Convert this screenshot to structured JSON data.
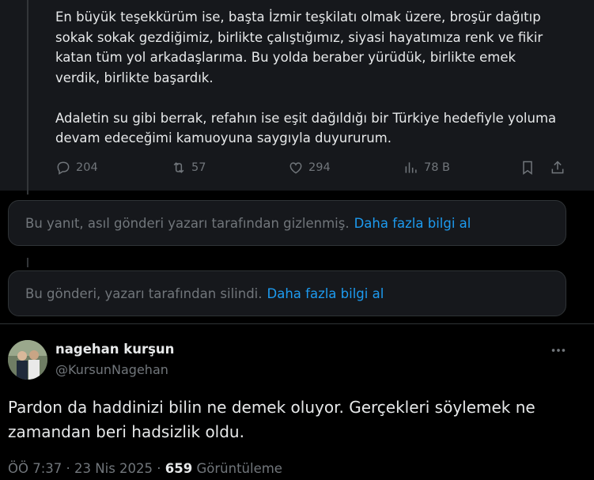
{
  "parent_tweet": {
    "text": "En büyük teşekkürüm ise, başta İzmir teşkilatı olmak üzere, broşür dağıtıp\nsokak sokak gezdiğimiz, birlikte çalıştığımız, siyasi hayatımıza renk ve fikir\nkatan tüm yol arkadaşlarıma. Bu yolda beraber yürüdük, birlikte emek\nverdik, birlikte başardık.\n\nAdaletin su gibi berrak, refahın ise eşit dağıldığı bir Türkiye hedefiyle yoluma\ndevam edeceğimi kamuoyuna saygıyla duyururum.",
    "replies": "204",
    "retweets": "57",
    "likes": "294",
    "views": "78 B"
  },
  "notices": [
    {
      "text": "Bu yanıt, asıl gönderi yazarı tarafından gizlenmiş.",
      "link": "Daha fazla bilgi al"
    },
    {
      "text": "Bu gönderi, yazarı tarafından silindi.",
      "link": "Daha fazla bilgi al"
    }
  ],
  "tweet": {
    "author_name": "nagehan kurşun",
    "author_handle": "@KursunNagehan",
    "text": "Pardon da haddinizi bilin ne demek oluyor. Gerçekleri söylemek ne zamandan beri hadsizlik oldu.",
    "time": "ÖÖ 7:37",
    "date": "23 Nis 2025",
    "view_count": "659",
    "view_label": "Görüntüleme"
  },
  "icons": [
    "reply-icon",
    "retweet-icon",
    "like-icon",
    "views-icon",
    "bookmark-icon",
    "share-icon",
    "more-icon"
  ],
  "colors": {
    "background": "#000000",
    "card": "#16181c",
    "link": "#1d9bf0",
    "muted": "#71767b",
    "text": "#e7e9ea"
  }
}
